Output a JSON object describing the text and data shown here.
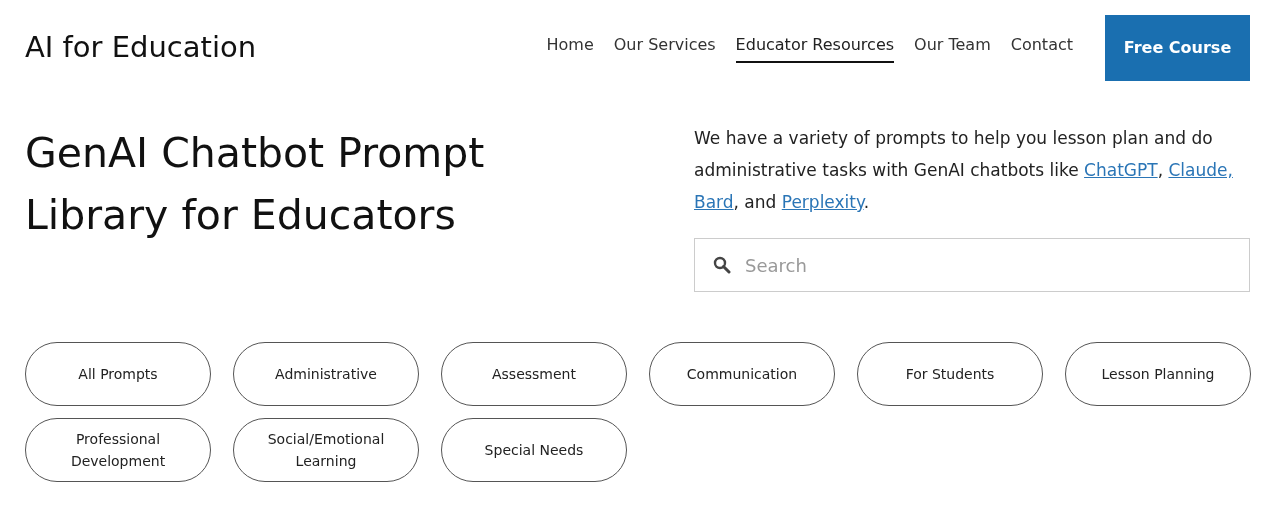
{
  "site_title": "AI for Education",
  "nav": [
    {
      "label": "Home",
      "selected": false
    },
    {
      "label": "Our Services",
      "selected": false
    },
    {
      "label": "Educator Resources",
      "selected": true
    },
    {
      "label": "Our Team",
      "selected": false
    },
    {
      "label": "Contact",
      "selected": false
    }
  ],
  "cta_button": "Free Course",
  "heading": "GenAI Chatbot Prompt Library for Educators",
  "intro": [
    {
      "kind": "text",
      "text": "We have a variety of prompts to help you lesson plan and do administrative tasks with GenAI chatbots like "
    },
    {
      "kind": "link",
      "text": "ChatGPT"
    },
    {
      "kind": "text",
      "text": ", "
    },
    {
      "kind": "link",
      "text": "Claude,",
      "space_after": true
    },
    {
      "kind": "link",
      "text": "Bard"
    },
    {
      "kind": "text",
      "text": ", and "
    },
    {
      "kind": "link",
      "text": "Perplexity"
    },
    {
      "kind": "text",
      "text": "."
    }
  ],
  "search": {
    "placeholder": "Search"
  },
  "categories": [
    "All Prompts",
    "Administrative",
    "Assessment",
    "Communication",
    "For Students",
    "Lesson Planning",
    "Professional Development",
    "Social/Emotional Learning",
    "Special Needs"
  ]
}
